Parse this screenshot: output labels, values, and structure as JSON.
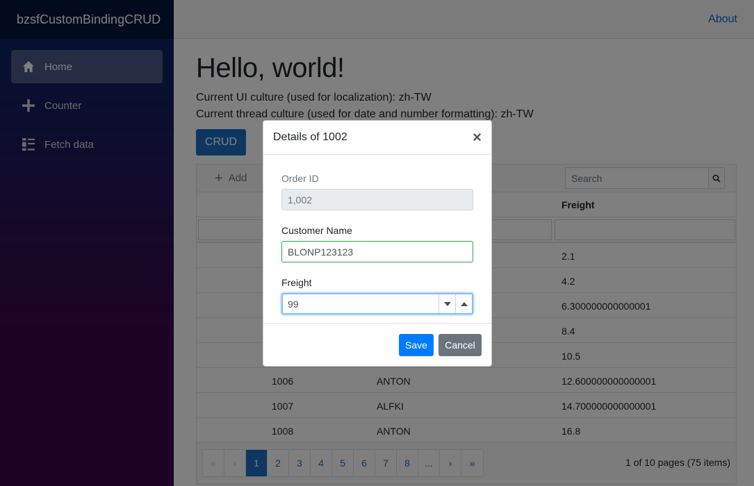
{
  "sidebar": {
    "brand": "bzsfCustomBindingCRUD",
    "items": [
      {
        "label": "Home",
        "icon": "home-icon",
        "active": true
      },
      {
        "label": "Counter",
        "icon": "plus-icon"
      },
      {
        "label": "Fetch data",
        "icon": "list-icon"
      }
    ]
  },
  "header": {
    "about_label": "About"
  },
  "main": {
    "title": "Hello, world!",
    "ui_culture": "Current UI culture (used for localization): zh-TW",
    "thread_culture": "Current thread culture (used for date and number formatting): zh-TW",
    "crud_label": "CRUD"
  },
  "grid": {
    "toolbar": {
      "add_label": "Add",
      "search_placeholder": "Search"
    },
    "columns": [
      "",
      "",
      "Freight"
    ],
    "rows": [
      {
        "id": "",
        "name": "",
        "freight": "2.1"
      },
      {
        "id": "",
        "name": "",
        "freight": "4.2"
      },
      {
        "id": "",
        "name": "",
        "freight": "6.300000000000001"
      },
      {
        "id": "",
        "name": "",
        "freight": "8.4"
      },
      {
        "id": "",
        "name": "",
        "freight": "10.5"
      },
      {
        "id": "1006",
        "name": "ANTON",
        "freight": "12.600000000000001"
      },
      {
        "id": "1007",
        "name": "ALFKI",
        "freight": "14.700000000000001"
      },
      {
        "id": "1008",
        "name": "ANTON",
        "freight": "16.8"
      }
    ],
    "pager": {
      "pages": [
        "1",
        "2",
        "3",
        "4",
        "5",
        "6",
        "7",
        "8",
        "..."
      ],
      "current": "1",
      "info": "1 of 10 pages (75 items)"
    }
  },
  "modal": {
    "title": "Details of 1002",
    "close_symbol": "×",
    "order_id_label": "Order ID",
    "order_id_value": "1,002",
    "customer_label": "Customer Name",
    "customer_value": "BLONP123123",
    "freight_label": "Freight",
    "freight_value": "99",
    "save_label": "Save",
    "cancel_label": "Cancel"
  },
  "colors": {
    "primary": "#007bff",
    "crud_button": "#1b6ec2",
    "valid_border": "#28a745",
    "secondary": "#6c757d"
  }
}
